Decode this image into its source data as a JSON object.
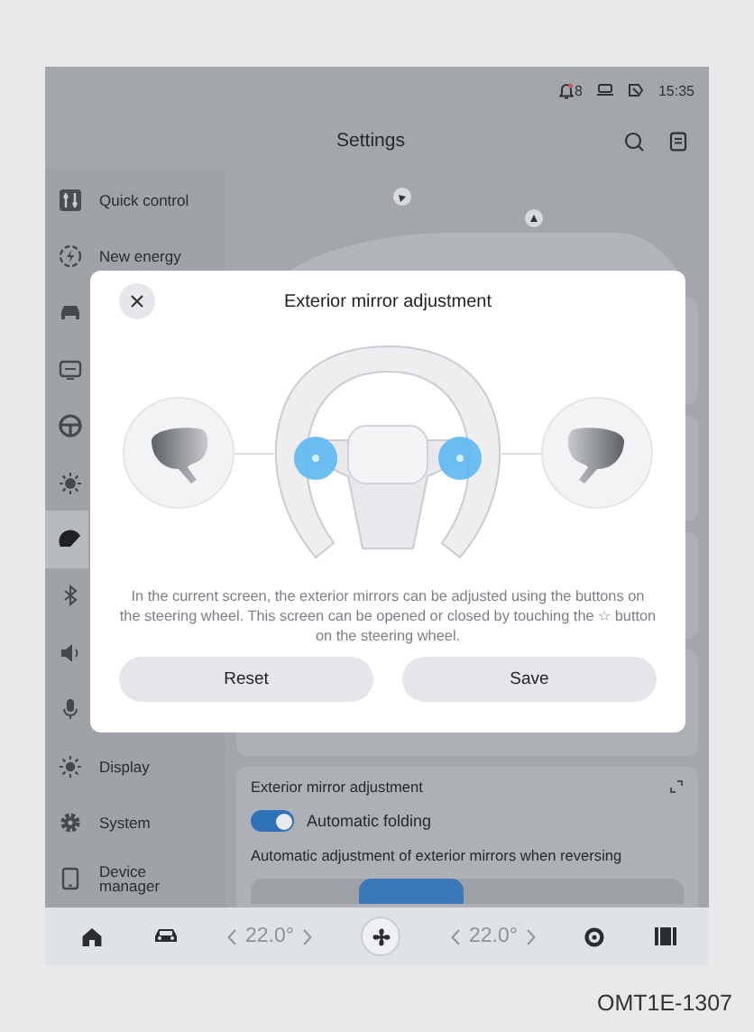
{
  "status_bar": {
    "notification_count": "8",
    "time": "15:35"
  },
  "header": {
    "title": "Settings"
  },
  "sidebar": {
    "items": [
      {
        "label": "Quick control",
        "selected": false
      },
      {
        "label": "New energy",
        "selected": false
      },
      {
        "selected": false
      },
      {
        "selected": false
      },
      {
        "selected": false
      },
      {
        "selected": false
      },
      {
        "selected": true
      },
      {
        "selected": false
      },
      {
        "selected": false
      },
      {
        "selected": false
      },
      {
        "label": "Display",
        "selected": false
      },
      {
        "label": "System",
        "selected": false
      },
      {
        "label": "Device manager",
        "selected": false
      }
    ]
  },
  "content": {
    "section_title": "Exterior mirror adjustment",
    "toggle": {
      "label": "Automatic folding",
      "on": true
    },
    "option_label": "Automatic adjustment of exterior mirrors when reversing"
  },
  "dialog": {
    "title": "Exterior mirror adjustment",
    "message": "In the current screen, the exterior mirrors can be adjusted using the buttons on the steering wheel. This screen can be opened or closed by touching the ☆ button on the steering wheel.",
    "buttons": [
      "Reset",
      "Save"
    ]
  },
  "climate_bar": {
    "left_temp": "22.0°",
    "right_temp": "22.0°"
  },
  "figure_code": "OMT1E-1307"
}
